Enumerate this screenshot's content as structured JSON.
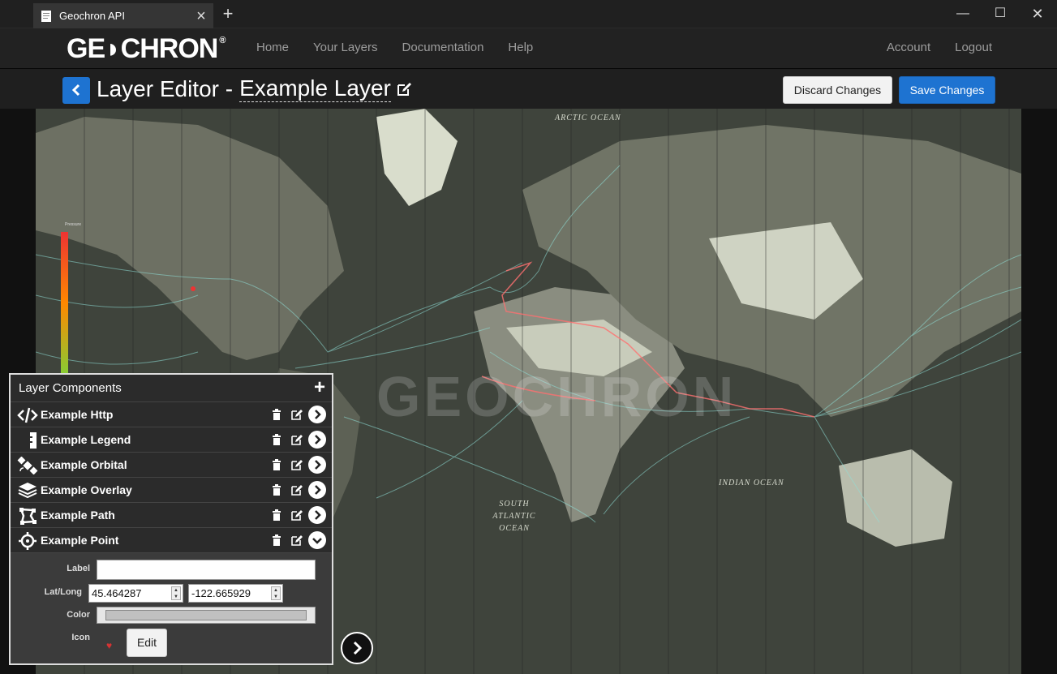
{
  "browser": {
    "tab_title": "Geochron API",
    "new_tab": "+",
    "close": "×"
  },
  "nav": {
    "logo_text": "GE◗CHRON",
    "logo_mark": "®",
    "links_left": [
      "Home",
      "Your Layers",
      "Documentation",
      "Help"
    ],
    "links_right": [
      "Account",
      "Logout"
    ]
  },
  "editor": {
    "title_prefix": "Layer Editor -",
    "layer_name": "Example Layer",
    "discard_label": "Discard Changes",
    "save_label": "Save Changes"
  },
  "map": {
    "watermark": "GEOCHRON",
    "oceans": [
      "ARCTIC OCEAN",
      "INDIAN OCEAN",
      "SOUTH ATLANTIC OCEAN"
    ],
    "legend_label": "Pressure"
  },
  "panel": {
    "title": "Layer Components",
    "add": "+",
    "components": [
      {
        "name": "Example Http",
        "icon": "code-icon"
      },
      {
        "name": "Example Legend",
        "icon": "legend-icon"
      },
      {
        "name": "Example Orbital",
        "icon": "satellite-icon"
      },
      {
        "name": "Example Overlay",
        "icon": "layers-icon"
      },
      {
        "name": "Example Path",
        "icon": "path-icon"
      },
      {
        "name": "Example Point",
        "icon": "crosshair-icon",
        "expanded": true
      }
    ],
    "details": {
      "label_label": "Label",
      "label_value": "",
      "latlong_label": "Lat/Long",
      "lat": "45.464287",
      "long": "-122.665929",
      "color_label": "Color",
      "icon_label": "Icon",
      "icon_glyph": "♥",
      "edit_label": "Edit"
    }
  },
  "colors": {
    "accent": "#1e73d1",
    "navbar": "#222222",
    "map_land": "#4b4f45",
    "shipping": "#8fe0d8"
  }
}
